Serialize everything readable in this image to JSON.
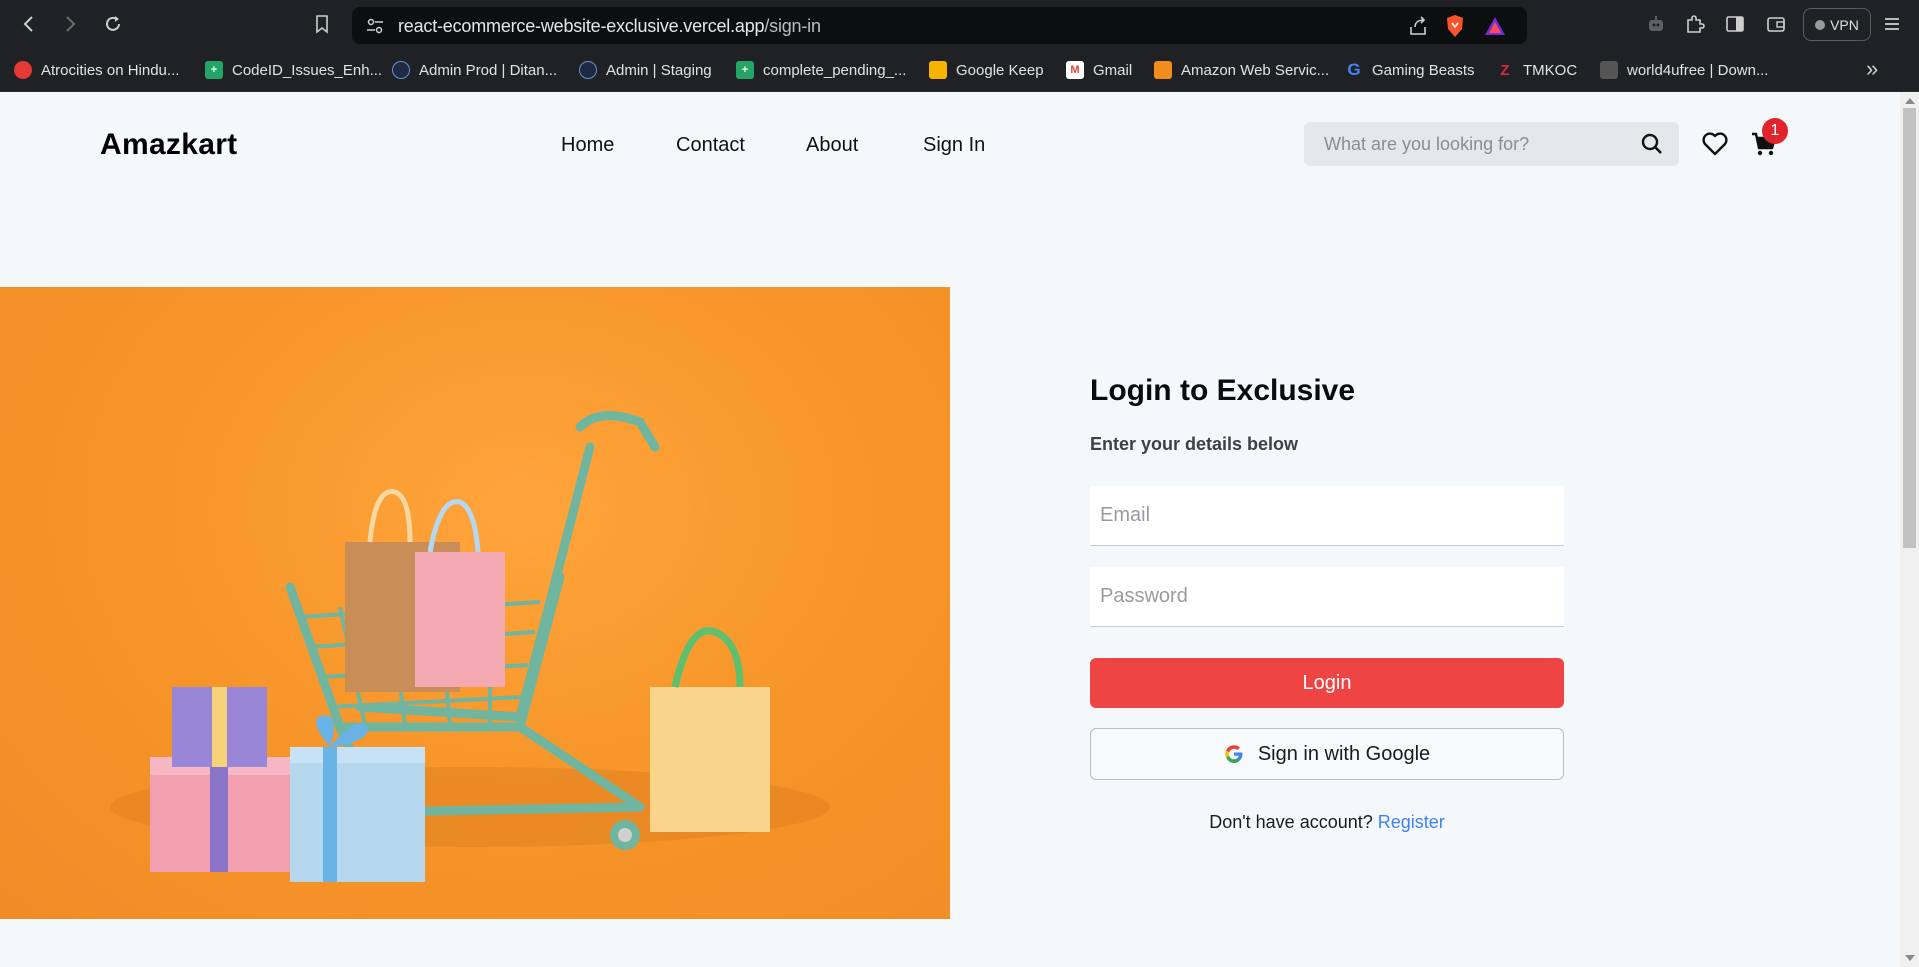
{
  "browser": {
    "url_host": "react-ecommerce-website-exclusive.vercel.app",
    "url_path": "/sign-in",
    "vpn_label": "VPN",
    "bookmarks": [
      {
        "label": "Atrocities on Hindu...",
        "icon": "red-circle-icon",
        "color": "#e53935"
      },
      {
        "label": "CodeID_Issues_Enh...",
        "icon": "sheets-icon",
        "color": "#23a566"
      },
      {
        "label": "Admin Prod | Ditan...",
        "icon": "ditan-icon",
        "color": "#2a5fa8"
      },
      {
        "label": "Admin | Staging",
        "icon": "ditan-icon",
        "color": "#2a5fa8"
      },
      {
        "label": "complete_pending_...",
        "icon": "sheets-icon",
        "color": "#23a566"
      },
      {
        "label": "Google Keep",
        "icon": "keep-icon",
        "color": "#f6b400"
      },
      {
        "label": "Gmail",
        "icon": "gmail-icon",
        "color": "#ea4335"
      },
      {
        "label": "Amazon Web Servic...",
        "icon": "aws-icon",
        "color": "#f28c1c"
      },
      {
        "label": "Gaming Beasts",
        "icon": "google-icon",
        "color": "#4285f4"
      },
      {
        "label": "TMKOC",
        "icon": "tmkoc-icon",
        "color": "#d8283a"
      },
      {
        "label": "world4ufree | Down...",
        "icon": "film-icon",
        "color": "#9e9e9e"
      }
    ]
  },
  "header": {
    "logo": "Amazkart",
    "nav": [
      "Home",
      "Contact",
      "About",
      "Sign In"
    ],
    "search_placeholder": "What are you looking for?",
    "cart_count": "1"
  },
  "login": {
    "title": "Login to Exclusive",
    "subtitle": "Enter your details below",
    "email_placeholder": "Email",
    "password_placeholder": "Password",
    "login_button": "Login",
    "google_button": "Sign in with Google",
    "no_account_text": "Don't have account?",
    "register_link": "Register"
  },
  "colors": {
    "accent": "#ef4444",
    "link": "#3b82f6",
    "hero_bg": "#f7962a",
    "badge": "#e0242b"
  }
}
